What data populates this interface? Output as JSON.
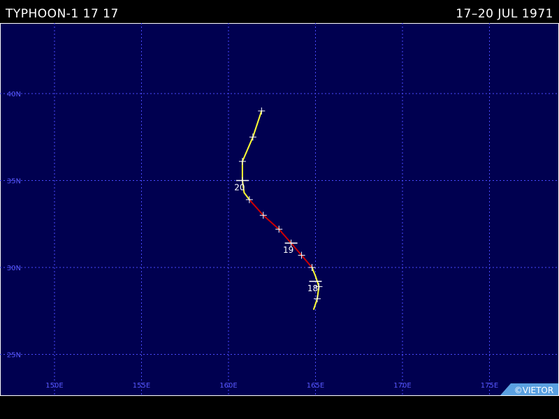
{
  "header": {
    "storm_name": "TYPHOON-1 17 17",
    "date_range": "17–20 JUL 1971"
  },
  "credit": "©VIETOR",
  "colors": {
    "background": "#000050",
    "grid": "#4a4aff",
    "axis_labels": "#5a5aff",
    "track_storm": "#ffff33",
    "track_typhoon": "#cc0000",
    "credit_bg": "#5aa0e0"
  },
  "map": {
    "lat_labels": [
      {
        "lat": 40,
        "label": "40N"
      },
      {
        "lat": 35,
        "label": "35N"
      },
      {
        "lat": 30,
        "label": "30N"
      },
      {
        "lat": 25,
        "label": "25N"
      }
    ],
    "lon_labels": [
      {
        "lon": 150,
        "label": "150E"
      },
      {
        "lon": 155,
        "label": "155E"
      },
      {
        "lon": 160,
        "label": "160E"
      },
      {
        "lon": 165,
        "label": "165E"
      },
      {
        "lon": 170,
        "label": "170E"
      },
      {
        "lon": 175,
        "label": "175E"
      }
    ]
  },
  "track": {
    "segments": [
      {
        "intensity": "storm",
        "points": [
          [
            164.9,
            27.6
          ],
          [
            165.1,
            28.2
          ],
          [
            165.2,
            28.9
          ],
          [
            165.0,
            29.5
          ],
          [
            164.8,
            30.0
          ]
        ]
      },
      {
        "intensity": "typhoon",
        "points": [
          [
            164.8,
            30.0
          ],
          [
            164.2,
            30.7
          ],
          [
            163.6,
            31.4
          ],
          [
            162.9,
            32.2
          ],
          [
            162.0,
            33.0
          ],
          [
            161.2,
            33.9
          ]
        ]
      },
      {
        "intensity": "storm",
        "points": [
          [
            161.2,
            33.9
          ],
          [
            160.9,
            34.3
          ],
          [
            160.8,
            35.0
          ],
          [
            160.8,
            36.1
          ],
          [
            161.4,
            37.5
          ],
          [
            161.9,
            39.0
          ]
        ]
      }
    ],
    "markers": [
      [
        165.1,
        28.2
      ],
      [
        165.2,
        28.9
      ],
      [
        164.8,
        30.0
      ],
      [
        164.2,
        30.7
      ],
      [
        163.6,
        31.4
      ],
      [
        162.9,
        32.2
      ],
      [
        162.0,
        33.0
      ],
      [
        161.2,
        33.9
      ],
      [
        160.8,
        35.0
      ],
      [
        160.8,
        36.1
      ],
      [
        161.4,
        37.5
      ],
      [
        161.9,
        39.0
      ]
    ],
    "day_labels": [
      {
        "text": "18",
        "lon": 165.0,
        "lat": 29.2
      },
      {
        "text": "19",
        "lon": 163.6,
        "lat": 31.4
      },
      {
        "text": "20",
        "lon": 160.8,
        "lat": 35.0
      }
    ]
  }
}
